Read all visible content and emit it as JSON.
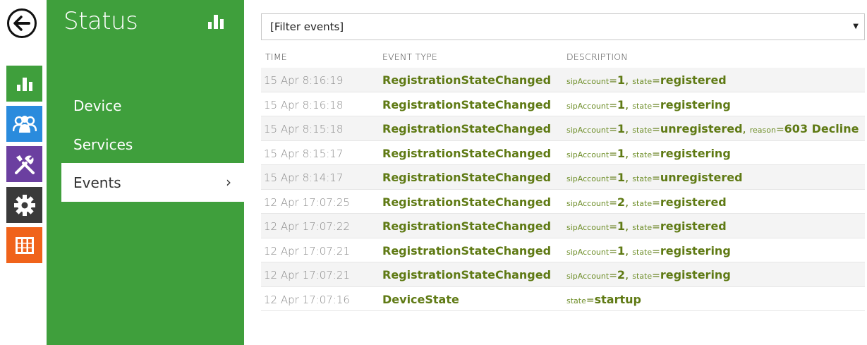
{
  "nav": {
    "title": "Status",
    "items": [
      {
        "label": "Device"
      },
      {
        "label": "Services"
      },
      {
        "label": "Events",
        "chevron": "›"
      }
    ]
  },
  "rail": {
    "icons": [
      "back-arrow-icon",
      "bar-chart-icon",
      "users-icon",
      "tools-icon",
      "gear-icon",
      "grid-icon"
    ],
    "colors": {
      "status": "#3f9f3c",
      "users": "#2a8bdd",
      "tools": "#6b3fa0",
      "settings": "#3a3a3a",
      "apps": "#f0631b"
    }
  },
  "filter": {
    "value": "[Filter events]",
    "caret": "▼"
  },
  "table": {
    "headers": {
      "time": "TIME",
      "type": "EVENT TYPE",
      "desc": "DESCRIPTION"
    },
    "rows": [
      {
        "time": "15 Apr 8:16:19",
        "type": "RegistrationStateChanged",
        "params": [
          {
            "k": "sipAccount",
            "v": "1"
          },
          {
            "k": "state",
            "v": "registered"
          }
        ]
      },
      {
        "time": "15 Apr 8:16:18",
        "type": "RegistrationStateChanged",
        "params": [
          {
            "k": "sipAccount",
            "v": "1"
          },
          {
            "k": "state",
            "v": "registering"
          }
        ]
      },
      {
        "time": "15 Apr 8:15:18",
        "type": "RegistrationStateChanged",
        "params": [
          {
            "k": "sipAccount",
            "v": "1"
          },
          {
            "k": "state",
            "v": "unregistered"
          },
          {
            "k": "reason",
            "v": "603 Decline"
          }
        ]
      },
      {
        "time": "15 Apr 8:15:17",
        "type": "RegistrationStateChanged",
        "params": [
          {
            "k": "sipAccount",
            "v": "1"
          },
          {
            "k": "state",
            "v": "registering"
          }
        ]
      },
      {
        "time": "15 Apr 8:14:17",
        "type": "RegistrationStateChanged",
        "params": [
          {
            "k": "sipAccount",
            "v": "1"
          },
          {
            "k": "state",
            "v": "unregistered"
          }
        ]
      },
      {
        "time": "12 Apr 17:07:25",
        "type": "RegistrationStateChanged",
        "params": [
          {
            "k": "sipAccount",
            "v": "2"
          },
          {
            "k": "state",
            "v": "registered"
          }
        ]
      },
      {
        "time": "12 Apr 17:07:22",
        "type": "RegistrationStateChanged",
        "params": [
          {
            "k": "sipAccount",
            "v": "1"
          },
          {
            "k": "state",
            "v": "registered"
          }
        ]
      },
      {
        "time": "12 Apr 17:07:21",
        "type": "RegistrationStateChanged",
        "params": [
          {
            "k": "sipAccount",
            "v": "1"
          },
          {
            "k": "state",
            "v": "registering"
          }
        ]
      },
      {
        "time": "12 Apr 17:07:21",
        "type": "RegistrationStateChanged",
        "params": [
          {
            "k": "sipAccount",
            "v": "2"
          },
          {
            "k": "state",
            "v": "registering"
          }
        ]
      },
      {
        "time": "12 Apr 17:07:16",
        "type": "DeviceState",
        "params": [
          {
            "k": "state",
            "v": "startup"
          }
        ]
      }
    ]
  }
}
